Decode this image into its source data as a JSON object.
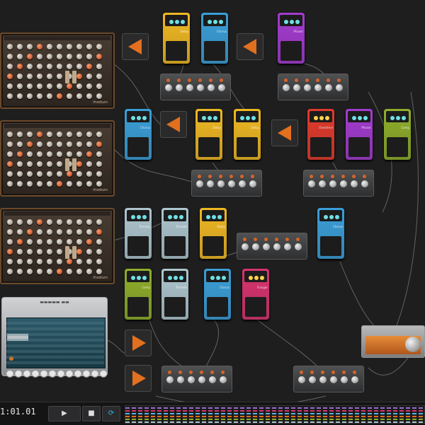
{
  "transport": {
    "time_display": "1:01.01",
    "play_label": "▶",
    "stop_label": "■",
    "loop_label": "⟳"
  },
  "modules": {
    "synth_brand": "rhodium",
    "sequencer_title": "▬▬▬▬▬ ▬▬",
    "pedal_names": {
      "yellow": "Delay",
      "blue": "Chorus",
      "purple": "Phaser",
      "red": "Overdrive",
      "green": "Comp",
      "pink": "Flanger",
      "silver": "Tremolo"
    }
  },
  "colors": {
    "accent_orange": "#e2701e",
    "pedal_yellow": "#f0b922",
    "pedal_blue": "#3a9fd9",
    "pedal_purple": "#a43bd1",
    "pedal_red": "#e23a2c",
    "pedal_green": "#8fae2a",
    "pedal_pink": "#d9336f",
    "pedal_silver": "#aec6cf"
  }
}
